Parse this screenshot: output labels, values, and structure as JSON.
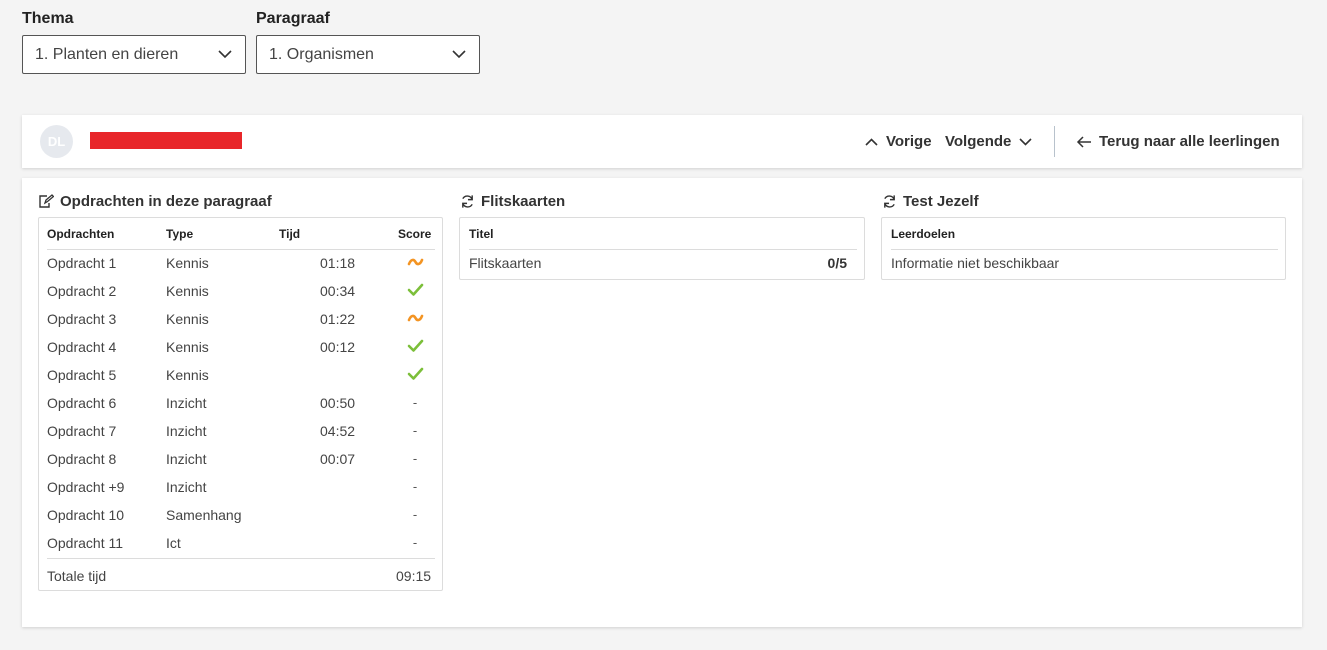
{
  "filters": {
    "thema": {
      "label": "Thema",
      "value": "1. Planten en dieren"
    },
    "paragraaf": {
      "label": "Paragraaf",
      "value": "1. Organismen"
    }
  },
  "header": {
    "avatar_initials": "DL",
    "prev_label": "Vorige",
    "next_label": "Volgende",
    "back_label": "Terug naar alle leerlingen"
  },
  "opdrachten": {
    "title": "Opdrachten in deze paragraaf",
    "columns": [
      "Opdrachten",
      "Type",
      "Tijd",
      "Score"
    ],
    "rows": [
      {
        "name": "Opdracht 1",
        "type": "Kennis",
        "time": "01:18",
        "score": "partial"
      },
      {
        "name": "Opdracht 2",
        "type": "Kennis",
        "time": "00:34",
        "score": "correct"
      },
      {
        "name": "Opdracht 3",
        "type": "Kennis",
        "time": "01:22",
        "score": "partial"
      },
      {
        "name": "Opdracht 4",
        "type": "Kennis",
        "time": "00:12",
        "score": "correct"
      },
      {
        "name": "Opdracht 5",
        "type": "Kennis",
        "time": "",
        "score": "correct"
      },
      {
        "name": "Opdracht 6",
        "type": "Inzicht",
        "time": "00:50",
        "score": "-"
      },
      {
        "name": "Opdracht 7",
        "type": "Inzicht",
        "time": "04:52",
        "score": "-"
      },
      {
        "name": "Opdracht 8",
        "type": "Inzicht",
        "time": "00:07",
        "score": "-"
      },
      {
        "name": "Opdracht +9",
        "type": "Inzicht",
        "time": "",
        "score": "-"
      },
      {
        "name": "Opdracht 10",
        "type": "Samenhang",
        "time": "",
        "score": "-"
      },
      {
        "name": "Opdracht 11",
        "type": "Ict",
        "time": "",
        "score": "-"
      }
    ],
    "total_label": "Totale tijd",
    "total_value": "09:15"
  },
  "flitskaarten": {
    "title": "Flitskaarten",
    "column": "Titel",
    "row_label": "Flitskaarten",
    "row_value": "0/5"
  },
  "test_jezelf": {
    "title": "Test Jezelf",
    "column": "Leerdoelen",
    "row_text": "Informatie niet beschikbaar"
  },
  "colors": {
    "partial": "#f39423",
    "correct": "#7cbf3a",
    "redaction": "#e8262a"
  },
  "icons": {
    "check": "checkmark-icon",
    "partial": "tilde-icon"
  }
}
